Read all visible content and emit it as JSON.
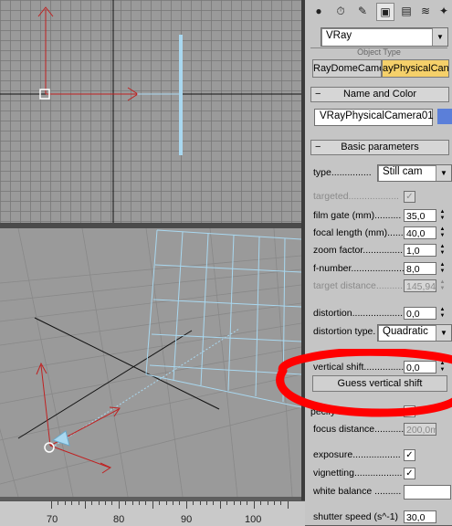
{
  "command_panel": {
    "tabs": [
      "sphere-icon",
      "camera-rig-icon",
      "light-icon",
      "camera-icon",
      "shape-icon",
      "helper-icon",
      "space-warp-icon"
    ],
    "active_tab": "camera-icon",
    "category_dropdown": "VRay",
    "object_type_header": "Object Type",
    "object_buttons": [
      {
        "label": "RayDomeCame"
      },
      {
        "label": "ayPhysicalCan"
      }
    ],
    "name_rollout": {
      "title": "Name and Color",
      "name_value": "VRayPhysicalCamera01",
      "color": "#5b7fd9"
    },
    "basic_rollout": {
      "title": "Basic parameters",
      "type_label": "type...............",
      "type_value": "Still cam",
      "targeted_label": "targeted...................",
      "targeted_check": "✓",
      "film_gate_label": "film gate (mm)..........",
      "film_gate_value": "35,0",
      "focal_length_label": "focal length (mm)......",
      "focal_length_value": "40,0",
      "zoom_label": "zoom factor...............",
      "zoom_value": "1,0",
      "fnumber_label": "f-number....................",
      "fnumber_value": "8,0",
      "target_distance_label": "target distance............",
      "target_distance_value": "145,945",
      "distortion_label": "distortion...................",
      "distortion_value": "0,0",
      "distortion_type_label": "distortion type.",
      "distortion_type_value": "Quadratic",
      "vertical_shift_label": "vertical shift...............",
      "vertical_shift_value": "0,0",
      "guess_button": "Guess vertical shift",
      "specify_focus_label": "pecify focus..............",
      "focus_distance_label": "focus distance...........",
      "focus_distance_value": "200,0m",
      "exposure_label": "exposure..................",
      "exposure_check": "✓",
      "vignetting_label": "vignetting..................",
      "vignetting_check": "✓",
      "white_balance_label": "white balance ..........",
      "shutter_label": "shutter speed (s^-1)",
      "shutter_value": "30,0"
    }
  },
  "timeline": {
    "labels": [
      "70",
      "80",
      "90",
      "100"
    ]
  },
  "colors": {
    "annotation_red": "#ff0000",
    "wire_blue": "#a9d8f0",
    "axis_red": "#c02020"
  }
}
